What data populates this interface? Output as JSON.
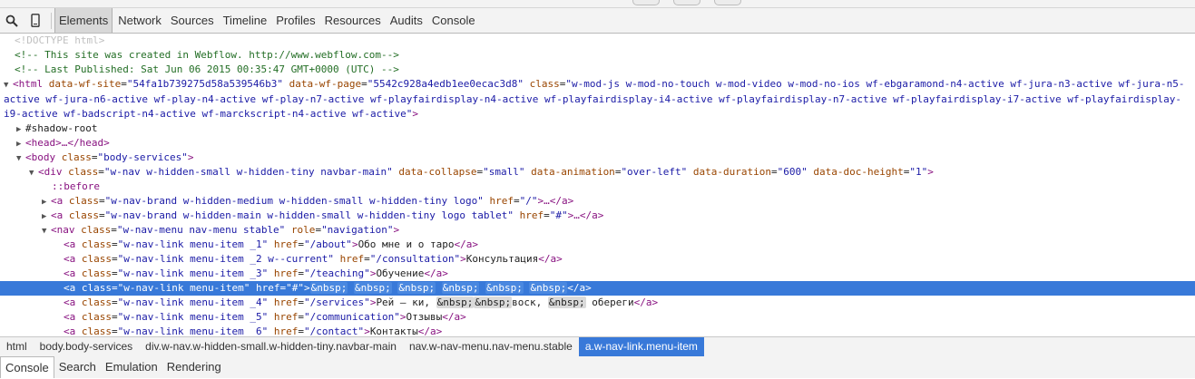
{
  "toolbar": {
    "tabs": [
      "Elements",
      "Network",
      "Sources",
      "Timeline",
      "Profiles",
      "Resources",
      "Audits",
      "Console"
    ],
    "active_tab": "Elements",
    "search_icon": "search-icon",
    "device_icon": "device-mode-icon"
  },
  "dom": {
    "doctype": "<!DOCTYPE html>",
    "comment1": "<!-- This site was created in Webflow. http://www.webflow.com-->",
    "comment2": "<!-- Last Published: Sat Jun 06 2015 00:35:47 GMT+0000 (UTC) -->",
    "html_open_tag": "<html",
    "html_attr1_name": "data-wf-site",
    "html_attr1_val": "\"54fa1b739275d58a539546b3\"",
    "html_attr2_name": "data-wf-page",
    "html_attr2_val": "\"5542c928a4edb1ee0ecac3d8\"",
    "html_attr3_name": "class",
    "html_attr3_val": "\"w-mod-js w-mod-no-touch w-mod-video w-mod-no-ios wf-ebgaramond-n4-active wf-jura-n3-active wf-jura-n5-active wf-jura-n6-active wf-play-n4-active wf-play-n7-active wf-playfairdisplay-n4-active wf-playfairdisplay-i4-active wf-playfairdisplay-n7-active wf-playfairdisplay-i7-active wf-playfairdisplay-i9-active wf-badscript-n4-active wf-marckscript-n4-active wf-active\"",
    "shadow_root": "#shadow-root",
    "head_tag": "<head>…</head>",
    "body_open": "<body",
    "body_class_val": "\"body-services\"",
    "div_open": "<div",
    "div_class_val": "\"w-nav w-hidden-small w-hidden-tiny navbar-main\"",
    "div_collapse_name": "data-collapse",
    "div_collapse_val": "\"small\"",
    "div_animation_name": "data-animation",
    "div_animation_val": "\"over-left\"",
    "div_duration_name": "data-duration",
    "div_duration_val": "\"600\"",
    "div_docheight_name": "data-doc-height",
    "div_docheight_val": "\"1\"",
    "before": "::before",
    "a_brand1_class": "\"w-nav-brand w-hidden-medium w-hidden-small w-hidden-tiny logo\"",
    "a_brand1_href": "\"/\"",
    "a_brand2_class": "\"w-nav-brand w-hidden-main w-hidden-small w-hidden-tiny logo tablet\"",
    "a_brand2_href": "\"#\"",
    "nav_class": "\"w-nav-menu nav-menu stable\"",
    "nav_role_name": "role",
    "nav_role": "\"navigation\"",
    "links": [
      {
        "class": "\"w-nav-link menu-item _1\"",
        "href": "\"/about\"",
        "text": "Обо мне и о таро"
      },
      {
        "class": "\"w-nav-link menu-item _2 w--current\"",
        "href": "\"/consultation\"",
        "text": "Консультация"
      },
      {
        "class": "\"w-nav-link menu-item _3\"",
        "href": "\"/teaching\"",
        "text": "Обучение"
      },
      {
        "class": "\"w-nav-link menu-item\"",
        "href": "\"#\"",
        "text": ""
      },
      {
        "class": "\"w-nav-link menu-item _4\"",
        "href": "\"/services\"",
        "text": ""
      },
      {
        "class": "\"w-nav-link menu-item _5\"",
        "href": "\"/communication\"",
        "text": "Отзывы"
      },
      {
        "class": "\"w-nav-link menu-item _6\"",
        "href": "\"/contact\"",
        "text": "Контакты"
      }
    ],
    "nbsp": "&nbsp;",
    "services_text_a": "Рей – ки, ",
    "services_text_b": "воск, ",
    "services_text_c": " обереги",
    "attr_class": "class",
    "attr_href": "href",
    "close_a": "</a>",
    "a_open": "<a",
    "nav_open": "<nav",
    "tag_end": ">",
    "ellipsis_close_a": ">…</a>"
  },
  "breadcrumbs": [
    "html",
    "body.body-services",
    "div.w-nav.w-hidden-small.w-hidden-tiny.navbar-main",
    "nav.w-nav-menu.nav-menu.stable",
    "a.w-nav-link.menu-item"
  ],
  "drawer": {
    "tabs": [
      "Console",
      "Search",
      "Emulation",
      "Rendering"
    ],
    "active_tab": "Console"
  },
  "colors": {
    "selection": "#3879d9",
    "tag": "#881280",
    "attr_name": "#994500",
    "attr_value": "#1a1aa6",
    "comment": "#236e25"
  }
}
